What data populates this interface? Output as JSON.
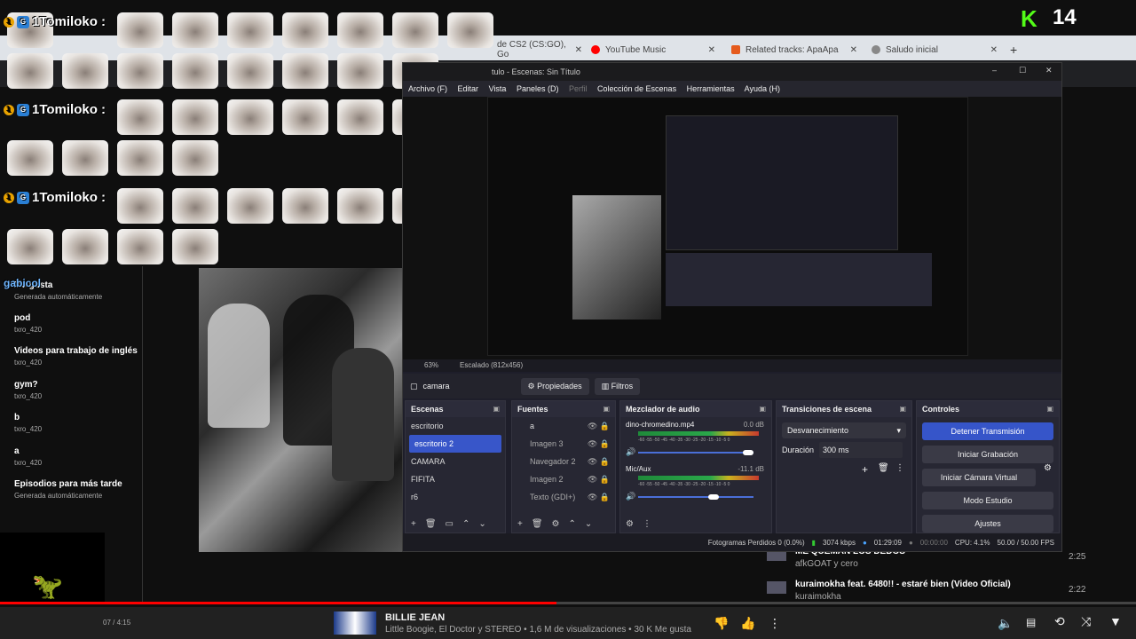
{
  "overlay": {
    "user_label": "1Tomiloko :",
    "kick_count": "14",
    "kick_logo": "K",
    "chat_user": "gabicol"
  },
  "browser": {
    "tabs": [
      {
        "label": "de CS2 (CS:GO), Go"
      },
      {
        "label": "YouTube Music"
      },
      {
        "label": "Related tracks: ApaApa"
      },
      {
        "label": "Saludo inicial"
      }
    ],
    "new_tab": "+"
  },
  "sidebar": {
    "items": [
      {
        "title": "Me gusta",
        "sub": "Generada automáticamente"
      },
      {
        "title": "pod",
        "sub": "txro_420"
      },
      {
        "title": "Videos para trabajo de inglés",
        "sub": "txro_420"
      },
      {
        "title": "gym?",
        "sub": "txro_420"
      },
      {
        "title": "b",
        "sub": "txro_420"
      },
      {
        "title": "a",
        "sub": "txro_420"
      },
      {
        "title": "Episodios para más tarde",
        "sub": "Generada automáticamente"
      }
    ]
  },
  "obs": {
    "title": "tulo - Escenas: Sin Título",
    "menu": [
      "Archivo (F)",
      "Editar",
      "Vista",
      "Paneles (D)",
      "Perfil",
      "Colección de Escenas",
      "Herramientas",
      "Ayuda (H)"
    ],
    "zoom": "63%",
    "scale": "Escalado (812x456)",
    "source_name": "camara",
    "properties": "Propiedades",
    "filters": "Filtros",
    "scenes_title": "Escenas",
    "scenes": [
      "escritorio",
      "escritorio 2",
      "CAMARA",
      "FIFITA",
      "r6"
    ],
    "sources_title": "Fuentes",
    "sources": [
      "a",
      "Imagen 3",
      "Navegador 2",
      "Imagen 2",
      "Texto (GDI+)"
    ],
    "mixer_title": "Mezclador de audio",
    "mixer": [
      {
        "name": "dino-chromedino.mp4",
        "db": "0.0 dB",
        "volume": 0.95
      },
      {
        "name": "Mic/Aux",
        "db": "-11.1 dB",
        "volume": 0.65
      }
    ],
    "meter_scale": "-60 -55 -50 -45 -40 -35 -30 -25 -20 -15 -10 -5 0",
    "transitions_title": "Transiciones de escena",
    "transition_value": "Desvanecimiento",
    "duration_label": "Duración",
    "duration_value": "300 ms",
    "controls_title": "Controles",
    "controls": [
      "Detener Transmisión",
      "Iniciar Grabación",
      "Iniciar Cámara Virtual",
      "Modo Estudio",
      "Ajustes"
    ],
    "status": {
      "dropped": "Fotogramas Perdidos 0 (0.0%)",
      "kbps": "3074 kbps",
      "live_time": "01:29:09",
      "rec_time": "00:00:00",
      "cpu": "CPU: 4.1%",
      "fps": "50.00 / 50.00 FPS"
    }
  },
  "recommendations": [
    {
      "title": "ME QUEMAN LOS DEDOS",
      "channel": "afkGOAT y cero",
      "duration": "2:25"
    },
    {
      "title": "kuraimokha feat. 6480!! - estaré bien (Video Oficial)",
      "channel": "kuraimokha",
      "duration": "2:22"
    }
  ],
  "player": {
    "time": "07 / 4:15",
    "progress": 0.49,
    "title": "BILLIE JEAN",
    "subtitle": "Little Boogie, El Doctor y STEREO • 1,6 M de visualizaciones • 30 K Me gusta"
  },
  "colors": {
    "accent": "#3655c9",
    "kick": "#53fc18",
    "yt_red": "#ff0000"
  }
}
